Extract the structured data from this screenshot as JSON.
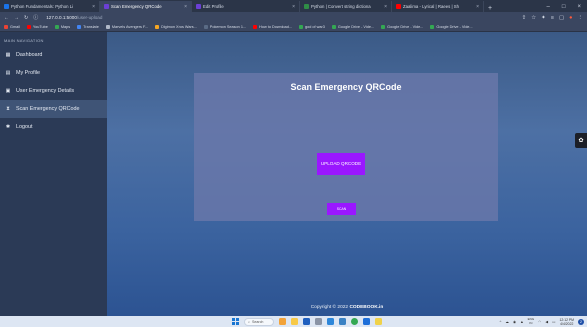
{
  "browser": {
    "tabs": [
      {
        "label": "Python Fundamentals: Python Li",
        "icon": "python-course-icon",
        "color": "#1a73e8",
        "active": false
      },
      {
        "label": "Scan Emergency QRCode",
        "icon": "page-icon",
        "color": "#6b3fd6",
        "active": true
      },
      {
        "label": "Edit Profile",
        "icon": "page-icon",
        "color": "#6b3fd6",
        "active": false
      },
      {
        "label": "Python | Convert string dictiona",
        "icon": "gfg-icon",
        "color": "#2f8d46",
        "active": false
      },
      {
        "label": "Zaalima - Lyrical | Raees | Sh",
        "icon": "youtube-icon",
        "color": "#ff0000",
        "active": false
      }
    ],
    "url": {
      "host": "127.0.0.1:5000",
      "path": "/user-upload"
    },
    "bookmarks": [
      {
        "label": "Gmail",
        "color": "#ea4335"
      },
      {
        "label": "YouTube",
        "color": "#ff0000"
      },
      {
        "label": "Maps",
        "color": "#34a853"
      },
      {
        "label": "Translate",
        "color": "#4285f4"
      },
      {
        "label": "Marvels Avengers F...",
        "color": "#b0b8c8"
      },
      {
        "label": "Digimon Xros Wars...",
        "color": "#f6a623"
      },
      {
        "label": "Pokemon Season 1...",
        "color": "#5a6b85"
      },
      {
        "label": "How to Download...",
        "color": "#ff0000"
      },
      {
        "label": "god of war3",
        "color": "#34a853"
      },
      {
        "label": "Google Drive - Vide...",
        "color": "#34a853"
      },
      {
        "label": "Google Drive - Vide...",
        "color": "#34a853"
      },
      {
        "label": "Google Drive - Vide...",
        "color": "#34a853"
      }
    ]
  },
  "sidebar": {
    "heading": "MAIN NAVIGATION",
    "items": [
      {
        "label": "Dashboard",
        "icon": "dashboard-icon",
        "glyph": "▦"
      },
      {
        "label": "My Profile",
        "icon": "profile-icon",
        "glyph": "▤"
      },
      {
        "label": "User Emergency Details",
        "icon": "details-icon",
        "glyph": "▣"
      },
      {
        "label": "Scan Emergency QRCode",
        "icon": "qrcode-icon",
        "glyph": "⧗"
      },
      {
        "label": "Logout",
        "icon": "logout-icon",
        "glyph": "✱"
      }
    ]
  },
  "main": {
    "title": "Scan Emergency QRCode",
    "upload_button": "UPLOAD QRCODE",
    "scan_button": "SCAN",
    "accent_color": "#9a17ff"
  },
  "footer": {
    "prefix": "Copyright © 2022",
    "brand": "CODEBOOK.in"
  },
  "taskbar": {
    "search_label": "Search",
    "language": "ENG",
    "region": "IN",
    "time": "12:12 PM",
    "date": "4/4/2022"
  }
}
